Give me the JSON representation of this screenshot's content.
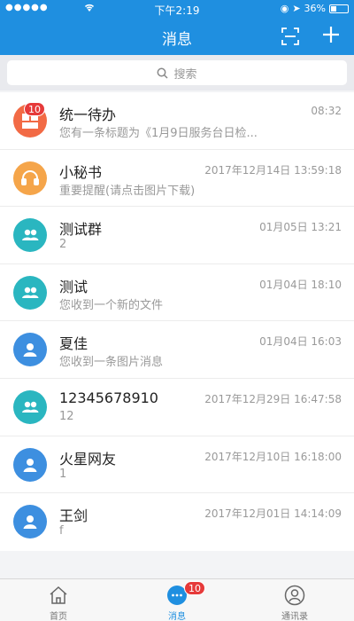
{
  "status_bar": {
    "signal": "●●●●●",
    "time": "下午2:19",
    "battery": "36%",
    "battery_level": 0.36
  },
  "nav": {
    "title": "消息"
  },
  "search": {
    "placeholder": "搜索"
  },
  "conversations": [
    {
      "name": "统一待办",
      "preview": "您有一条标题为《1月9日服务台日检...",
      "time": "08:32",
      "avatar_color": "#f26a45",
      "icon": "todo-icon",
      "badge": "10"
    },
    {
      "name": "小秘书",
      "preview": "重要提醒(请点击图片下载)",
      "time": "2017年12月14日 13:59:18",
      "avatar_color": "#f5a54a",
      "icon": "headset-icon",
      "badge": ""
    },
    {
      "name": "测试群",
      "preview": "2",
      "time": "01月05日 13:21",
      "avatar_color": "#2ab6c0",
      "icon": "group-icon",
      "badge": ""
    },
    {
      "name": "测试",
      "preview": "您收到一个新的文件",
      "time": "01月04日 18:10",
      "avatar_color": "#2ab6c0",
      "icon": "group-icon",
      "badge": ""
    },
    {
      "name": "夏佳",
      "preview": "您收到一条图片消息",
      "time": "01月04日 16:03",
      "avatar_color": "#3d8fe0",
      "icon": "person-icon",
      "badge": ""
    },
    {
      "name": "12345678910",
      "preview": "12",
      "time": "2017年12月29日 16:47:58",
      "avatar_color": "#2ab6c0",
      "icon": "group-icon",
      "badge": ""
    },
    {
      "name": "火星网友",
      "preview": "1",
      "time": "2017年12月10日 16:18:00",
      "avatar_color": "#3d8fe0",
      "icon": "person-icon",
      "badge": ""
    },
    {
      "name": "王剑",
      "preview": "f",
      "time": "2017年12月01日 14:14:09",
      "avatar_color": "#3d8fe0",
      "icon": "person-icon",
      "badge": ""
    }
  ],
  "tabbar": {
    "items": [
      {
        "label": "首页",
        "icon": "home-icon"
      },
      {
        "label": "消息",
        "icon": "chat-icon",
        "badge": "10"
      },
      {
        "label": "通讯录",
        "icon": "contacts-icon"
      }
    ]
  },
  "colors": {
    "primary": "#1f8fe0",
    "badge": "#e63a3a"
  }
}
